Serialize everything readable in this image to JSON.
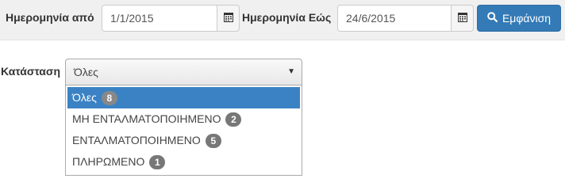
{
  "filters": {
    "date_from_label": "Ημερομηνία από",
    "date_from_value": "1/1/2015",
    "date_to_label": "Ημερομηνία Εώς",
    "date_to_value": "24/6/2015",
    "calendar_icon": "calendar-icon",
    "show_button_label": "Εμφάνιση",
    "show_button_icon": "search-icon",
    "accent_color": "#337ab7"
  },
  "status": {
    "label": "Κατάσταση",
    "selected": "Όλες",
    "options": [
      {
        "label": "Όλες",
        "count": "8",
        "selected": true
      },
      {
        "label": "ΜΗ ΕΝΤΑΛΜΑΤΟΠΟΙΗΜΕΝΟ",
        "count": "2",
        "selected": false
      },
      {
        "label": "ΕΝΤΑΛΜΑΤΟΠΟΙΗΜΕΝΟ",
        "count": "5",
        "selected": false
      },
      {
        "label": "ΠΛΗΡΩΜΕΝΟ",
        "count": "1",
        "selected": false
      }
    ]
  }
}
